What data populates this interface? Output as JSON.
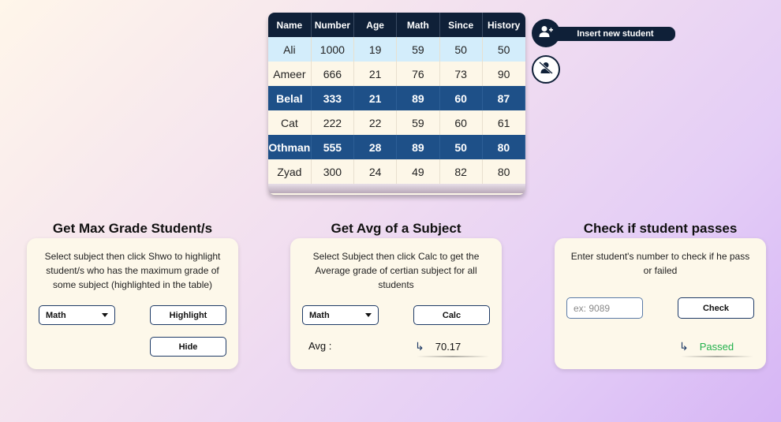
{
  "table": {
    "columns": [
      "Name",
      "Number",
      "Age",
      "Math",
      "Since",
      "History"
    ],
    "rows": [
      {
        "style": "light",
        "cells": [
          "Ali",
          "1000",
          "19",
          "59",
          "50",
          "50"
        ]
      },
      {
        "style": "cream",
        "cells": [
          "Ameer",
          "666",
          "21",
          "76",
          "73",
          "90"
        ]
      },
      {
        "style": "dark",
        "cells": [
          "Belal",
          "333",
          "21",
          "89",
          "60",
          "87"
        ]
      },
      {
        "style": "cream",
        "cells": [
          "Cat",
          "222",
          "22",
          "59",
          "60",
          "61"
        ]
      },
      {
        "style": "dark",
        "cells": [
          "Othman",
          "555",
          "28",
          "89",
          "50",
          "80"
        ]
      },
      {
        "style": "cream",
        "cells": [
          "Zyad",
          "300",
          "24",
          "49",
          "82",
          "80"
        ]
      }
    ]
  },
  "actions": {
    "insert_label": "Insert new student",
    "add_icon": "add-user-icon",
    "remove_icon": "remove-user-icon"
  },
  "max_panel": {
    "title": "Get Max Grade Student/s",
    "description": "Select subject then click Shwo to highlight student/s who has the maximum grade of some subject (highlighted in the table)",
    "selected_subject": "Math",
    "highlight_label": "Highlight",
    "hide_label": "Hide"
  },
  "avg_panel": {
    "title": "Get Avg of a Subject",
    "description": "Select Subject then click Calc to get the Average grade of certian subject for all students",
    "selected_subject": "Math",
    "calc_label": "Calc",
    "avg_label": "Avg :",
    "avg_value": "70.17"
  },
  "check_panel": {
    "title": "Check if student passes",
    "description": "Enter student's number to check if he pass or failed",
    "input_placeholder": "ex: 9089",
    "check_label": "Check",
    "result": "Passed",
    "result_color": "#22b14c"
  },
  "colors": {
    "navy": "#0f2038",
    "highlight_row": "#1e5088",
    "light_row": "#d3edfb",
    "cream": "#fdf8ea"
  }
}
